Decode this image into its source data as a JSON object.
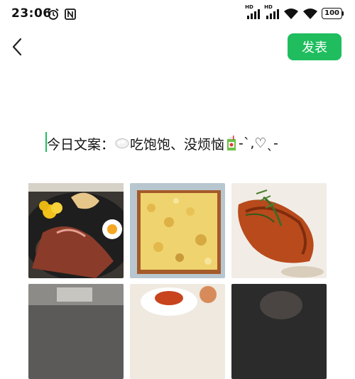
{
  "status_bar": {
    "time": "23:06",
    "network_label": "HD",
    "battery": "100"
  },
  "header": {
    "back_icon": "chevron-left-icon",
    "publish_label": "发表",
    "accent_color": "#1fbd5e"
  },
  "caption": {
    "text_part1": "今日文案：",
    "text_part2": "吃饱饱、没烦恼",
    "text_part3": " -ˋ,♡ˎ-"
  },
  "photos": [
    {
      "subject": "steak-spaghetti-egg"
    },
    {
      "subject": "baked-cheese-tray"
    },
    {
      "subject": "grilled-chicken-rosemary"
    },
    {
      "subject": "restaurant-interior"
    },
    {
      "subject": "pasta-plate"
    },
    {
      "subject": "dark-portrait"
    }
  ]
}
